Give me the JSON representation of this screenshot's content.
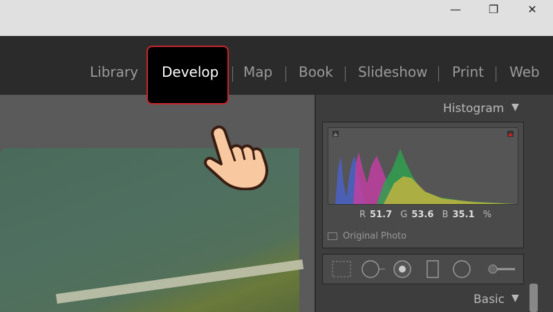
{
  "window": {
    "minimize_icon": "—",
    "restore_icon": "❐",
    "close_icon": "✕"
  },
  "modules": [
    "Library",
    "Develop",
    "Map",
    "Book",
    "Slideshow",
    "Print",
    "Web"
  ],
  "histogram": {
    "title": "Histogram",
    "r_label": "R",
    "r_value": "51.7",
    "g_label": "G",
    "g_value": "53.6",
    "b_label": "B",
    "b_value": "35.1",
    "unit": "%",
    "original_photo_label": "Original Photo"
  },
  "basic": {
    "title": "Basic"
  },
  "colors": {
    "highlight": "#c8262c",
    "accent": "#ffffff"
  }
}
